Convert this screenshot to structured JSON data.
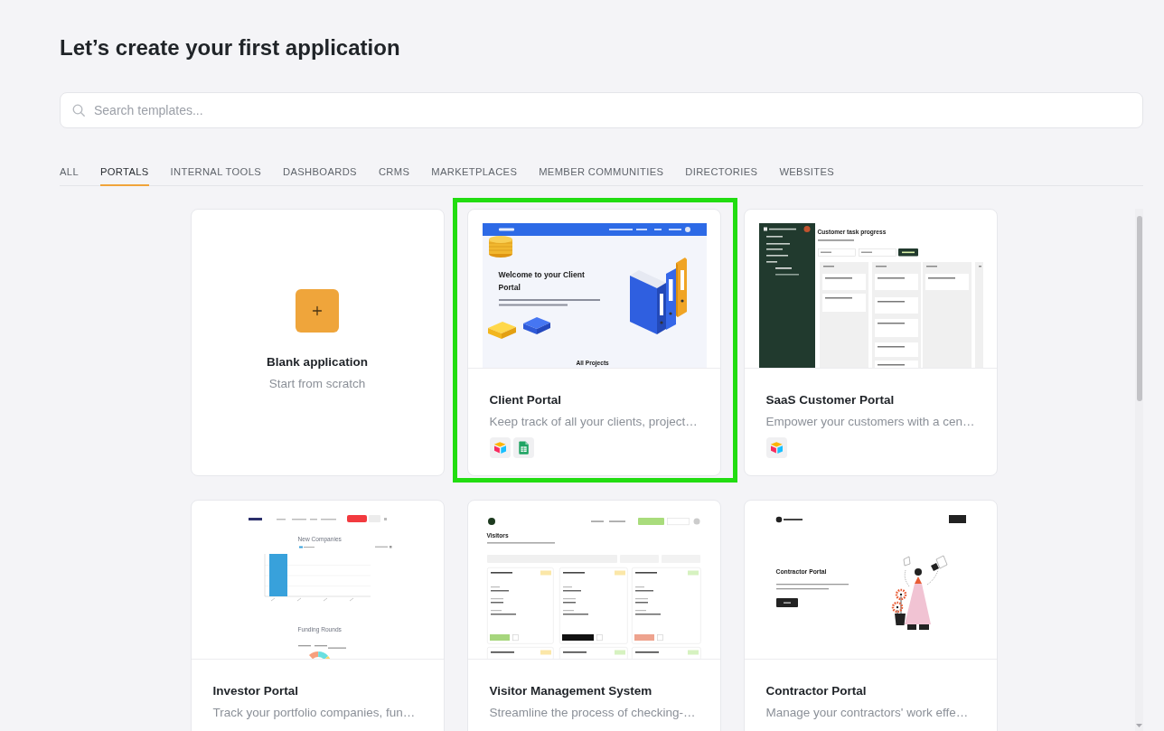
{
  "page": {
    "title": "Let’s create your first application"
  },
  "search": {
    "placeholder": "Search templates..."
  },
  "tabs": [
    {
      "label": "ALL",
      "selected": false
    },
    {
      "label": "PORTALS",
      "selected": true
    },
    {
      "label": "INTERNAL TOOLS",
      "selected": false
    },
    {
      "label": "DASHBOARDS",
      "selected": false
    },
    {
      "label": "CRMS",
      "selected": false
    },
    {
      "label": "MARKETPLACES",
      "selected": false
    },
    {
      "label": "MEMBER COMMUNITIES",
      "selected": false
    },
    {
      "label": "DIRECTORIES",
      "selected": false
    },
    {
      "label": "WEBSITES",
      "selected": false
    }
  ],
  "cards": [
    {
      "kind": "blank",
      "title": "Blank application",
      "subtitle": "Start from scratch",
      "highlighted": false
    },
    {
      "kind": "template",
      "title": "Client Portal",
      "description": "Keep track of all your clients, project…",
      "highlighted": true,
      "preview": {
        "kind": "client",
        "headline": "Welcome to your Client Portal",
        "section_title": "All Projects"
      },
      "integrations": [
        {
          "kind": "airtable"
        },
        {
          "kind": "sheets"
        }
      ]
    },
    {
      "kind": "template",
      "title": "SaaS Customer Portal",
      "description": "Empower your customers with a cen…",
      "highlighted": false,
      "preview": {
        "kind": "saas",
        "headline": "Customer task progress"
      },
      "integrations": [
        {
          "kind": "airtable"
        }
      ]
    },
    {
      "kind": "template",
      "title": "Investor Portal",
      "description": "Track your portfolio companies, fun…",
      "highlighted": false,
      "preview": {
        "kind": "investor",
        "chart_title": "New Companies",
        "section_title": "Funding Rounds"
      }
    },
    {
      "kind": "template",
      "title": "Visitor Management System",
      "description": "Streamline the process of checking-…",
      "highlighted": false,
      "preview": {
        "kind": "visitor",
        "headline": "Visitors"
      }
    },
    {
      "kind": "template",
      "title": "Contractor Portal",
      "description": "Manage your contractors' work effe…",
      "highlighted": false,
      "preview": {
        "kind": "contractor",
        "headline": "Contractor Portal"
      }
    }
  ]
}
